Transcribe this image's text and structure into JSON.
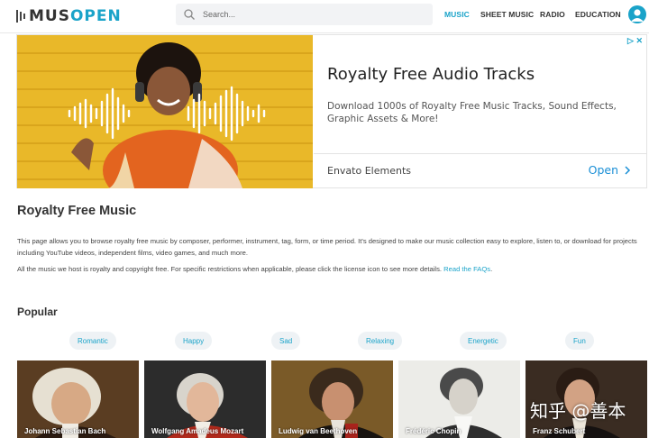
{
  "header": {
    "logo_mus": "MUS",
    "logo_open": "OPEN",
    "search_placeholder": "Search...",
    "nav": [
      "MUSIC",
      "SHEET MUSIC",
      "RADIO",
      "EDUCATION"
    ],
    "active_nav": "MUSIC",
    "accent_color": "#1aa3c9"
  },
  "ad": {
    "title": "Royalty Free Audio Tracks",
    "description": "Download 1000s of Royalty Free Music Tracks, Sound Effects, Graphic Assets & More!",
    "brand": "Envato Elements",
    "cta": "Open",
    "badge_icons": [
      "adchoices-icon",
      "close-icon"
    ]
  },
  "main": {
    "title": "Royalty Free Music",
    "intro": "This page allows you to browse royalty free music by composer, performer, instrument, tag, form, or time period. It's designed to make our music collection easy to explore, listen to, or download for projects including YouTube videos, independent films, video games, and much more.",
    "rights_text": "All the music we host is royalty and copyright free. For specific restrictions when applicable, please click the license icon to see more details. ",
    "faq_link": "Read the FAQs",
    "faq_suffix": "."
  },
  "popular": {
    "title": "Popular",
    "tags": [
      "Romantic",
      "Happy",
      "Sad",
      "Relaxing",
      "Energetic",
      "Fun"
    ],
    "composers": [
      "Johann Sebastian Bach",
      "Wolfgang Amadeus Mozart",
      "Ludwig van Beethoven",
      "Frédéric Chopin",
      "Franz Schubert"
    ]
  },
  "watermark": "知乎 @善本"
}
